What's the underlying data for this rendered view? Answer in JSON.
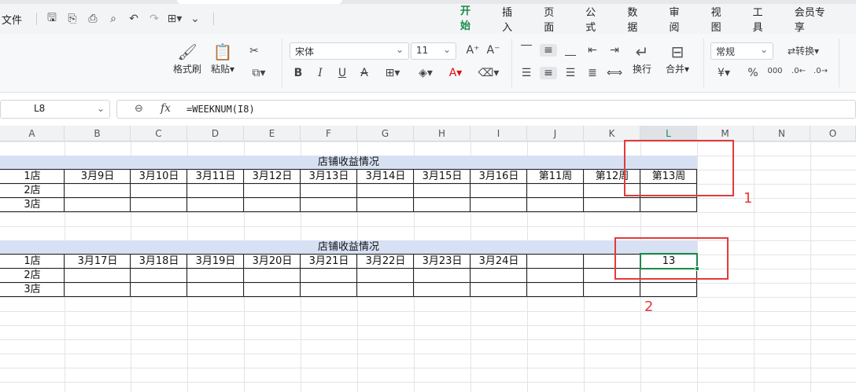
{
  "toolbar": {
    "file_label": "文件",
    "menu_tabs": [
      "开始",
      "插入",
      "页面",
      "公式",
      "数据",
      "审阅",
      "视图",
      "工具",
      "会员专享"
    ]
  },
  "ribbon": {
    "format_painter": "格式刷",
    "paste": "粘贴",
    "font_name": "宋体",
    "font_size": "11",
    "wrap": "换行",
    "merge": "合并",
    "number_format": "常规",
    "convert": "转换"
  },
  "formula_bar": {
    "cell_ref": "L8",
    "fx": "fx",
    "formula": "=WEEKNUM(I8)"
  },
  "columns": [
    "A",
    "B",
    "C",
    "D",
    "E",
    "F",
    "G",
    "H",
    "I",
    "J",
    "K",
    "L",
    "M",
    "N",
    "O"
  ],
  "sheet": {
    "table1": {
      "title": "店铺收益情况",
      "header": [
        "1店",
        "3月9日",
        "3月10日",
        "3月11日",
        "3月12日",
        "3月13日",
        "3月14日",
        "3月15日",
        "3月16日",
        "第11周",
        "第12周",
        "第13周"
      ],
      "rows": [
        "2店",
        "3店"
      ]
    },
    "table2": {
      "title": "店铺收益情况",
      "header": [
        "1店",
        "3月17日",
        "3月18日",
        "3月19日",
        "3月20日",
        "3月21日",
        "3月22日",
        "3月23日",
        "3月24日",
        "",
        "",
        "13"
      ],
      "rows": [
        "2店",
        "3店"
      ]
    }
  },
  "annotations": [
    "1",
    "2"
  ],
  "colors": {
    "accent": "#1a8a4a",
    "title_band": "#d7e1f3",
    "annotation": "#e43a3a"
  }
}
